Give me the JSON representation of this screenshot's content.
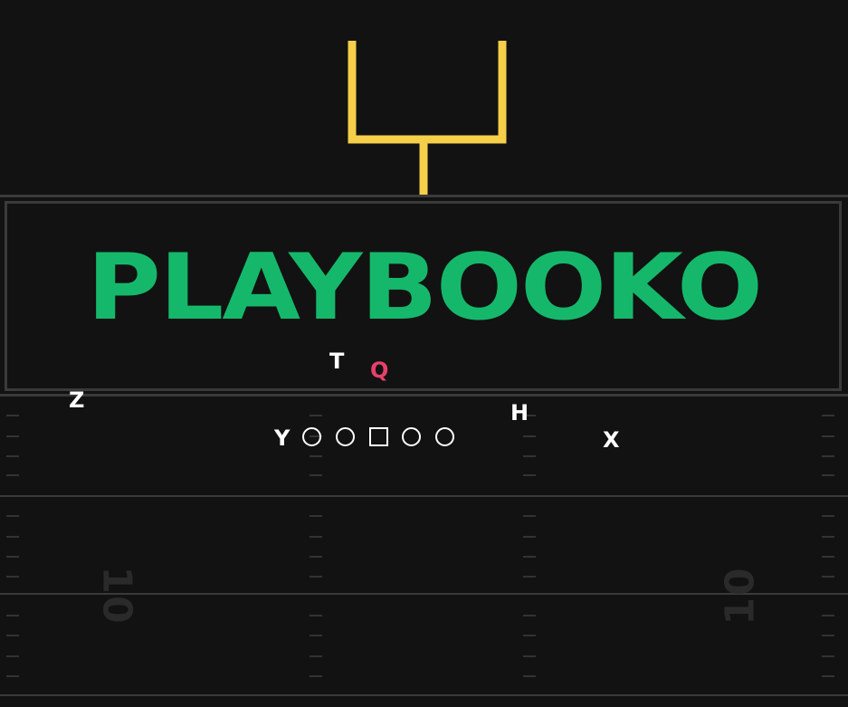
{
  "title": "PLAYBOOKO",
  "colors": {
    "background": "#121212",
    "title": "#15b86a",
    "goalpost": "#f5cf4a",
    "quarterback": "#e8406a",
    "players": "#ffffff"
  },
  "formation": {
    "players": {
      "t": "T",
      "q": "Q",
      "z": "Z",
      "h": "H",
      "y": "Y",
      "x": "X"
    },
    "line": [
      "circle",
      "circle",
      "square",
      "circle",
      "circle"
    ]
  },
  "field": {
    "yard_left": "10",
    "yard_right": "10"
  }
}
